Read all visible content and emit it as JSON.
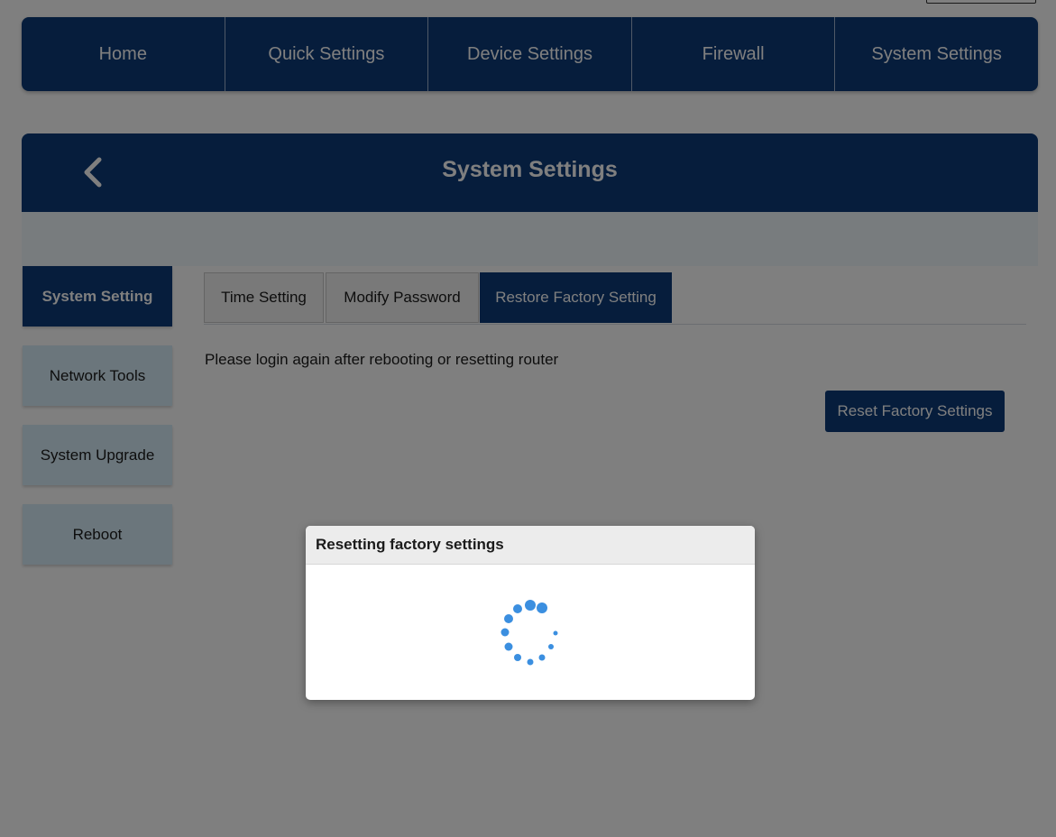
{
  "nav": {
    "items": [
      {
        "label": "Home"
      },
      {
        "label": "Quick Settings"
      },
      {
        "label": "Device Settings"
      },
      {
        "label": "Firewall"
      },
      {
        "label": "System Settings"
      }
    ]
  },
  "panel": {
    "title": "System Settings"
  },
  "sidebar": {
    "items": [
      {
        "label": "System Setting",
        "active": true
      },
      {
        "label": "Network Tools",
        "active": false
      },
      {
        "label": "System Upgrade",
        "active": false
      },
      {
        "label": "Reboot",
        "active": false
      }
    ]
  },
  "tabs": {
    "items": [
      {
        "label": "Time Setting",
        "active": false
      },
      {
        "label": "Modify Password",
        "active": false
      },
      {
        "label": "Restore Factory Setting",
        "active": true
      }
    ]
  },
  "content": {
    "notice": "Please login again after rebooting or resetting router",
    "reset_button": "Reset Factory Settings"
  },
  "dialog": {
    "title": "Resetting factory settings",
    "indicator": "loading-spinner-icon"
  },
  "colors": {
    "primary": "#0d3a78",
    "sidebar_inactive": "#d7ecf8",
    "spinner": "#3b8fe0"
  }
}
